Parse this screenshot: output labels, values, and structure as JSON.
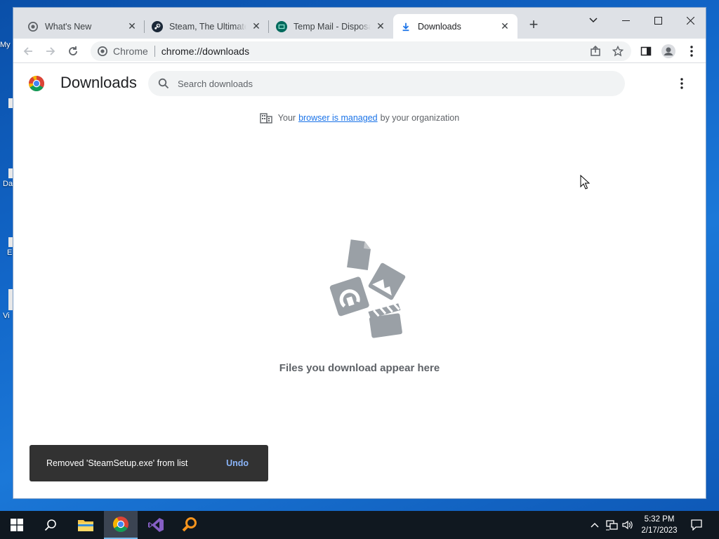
{
  "desktop": {
    "icon_fragments": [
      "My",
      "Da",
      "E",
      "Vi"
    ]
  },
  "browser": {
    "tabs": [
      {
        "title": "What's New",
        "active": false
      },
      {
        "title": "Steam, The Ultimate Online Game Platform",
        "active": false
      },
      {
        "title": "Temp Mail - Disposable Temporary Email",
        "active": false
      },
      {
        "title": "Downloads",
        "active": true
      }
    ],
    "omnibox": {
      "site_label": "Chrome",
      "url": "chrome://downloads"
    }
  },
  "downloads_page": {
    "title": "Downloads",
    "search_placeholder": "Search downloads",
    "managed_notice": {
      "prefix": "Your",
      "link": "browser is managed",
      "suffix": "by your organization"
    },
    "empty_message": "Files you download appear here",
    "toast": {
      "message": "Removed 'SteamSetup.exe' from list",
      "action": "Undo"
    }
  },
  "taskbar": {
    "clock_time": "5:32 PM",
    "clock_date": "2/17/2023"
  },
  "colors": {
    "accent": "#1a73e8",
    "toast_bg": "#323232",
    "toast_action": "#8ab4f8",
    "tabstrip_bg": "#dee1e6"
  }
}
